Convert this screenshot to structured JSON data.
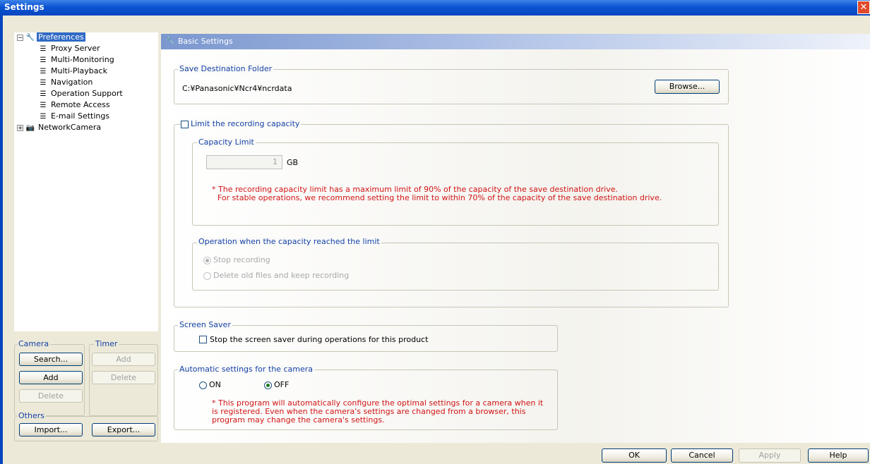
{
  "window": {
    "title": "Settings",
    "close_icon": "close-icon"
  },
  "tree": {
    "root_label": "Preferences",
    "children": [
      "Proxy Server",
      "Multi-Monitoring",
      "Multi-Playback",
      "Navigation",
      "Operation Support",
      "Remote Access",
      "E-mail Settings"
    ],
    "second_root_label": "NetworkCamera"
  },
  "left_groups": {
    "camera": {
      "caption": "Camera",
      "search": "Search...",
      "add": "Add",
      "delete": "Delete"
    },
    "timer": {
      "caption": "Timer",
      "add": "Add",
      "delete": "Delete"
    },
    "others": {
      "caption": "Others",
      "import": "Import...",
      "export": "Export..."
    }
  },
  "panel": {
    "header": "Basic Settings",
    "save_dest": {
      "caption": "Save Destination Folder",
      "path": "C:¥Panasonic¥Ncr4¥ncrdata",
      "browse": "Browse..."
    },
    "limit": {
      "checkbox_label": "Limit the recording capacity",
      "capacity_caption": "Capacity Limit",
      "value": "1",
      "unit": "GB",
      "note_line1": "* The recording capacity limit has a maximum limit of 90% of the capacity of the save destination drive.",
      "note_line2": "For stable operations, we recommend setting the limit to within 70% of the capacity of the save destination drive.",
      "operation_caption": "Operation when the capacity reached the limit",
      "opt_stop": "Stop recording",
      "opt_delete": "Delete old files and keep recording"
    },
    "screen_saver": {
      "caption": "Screen Saver",
      "checkbox_label": "Stop the screen saver during operations for this product"
    },
    "auto": {
      "caption": "Automatic settings for the camera",
      "on": "ON",
      "off": "OFF",
      "note_line1": "* This program will automatically configure the optimal settings for a camera when it",
      "note_line2": "is registered. Even when the camera's settings are changed from a browser, this",
      "note_line3": "program may change the camera's settings."
    }
  },
  "footer": {
    "ok": "OK",
    "cancel": "Cancel",
    "apply": "Apply",
    "help": "Help"
  }
}
